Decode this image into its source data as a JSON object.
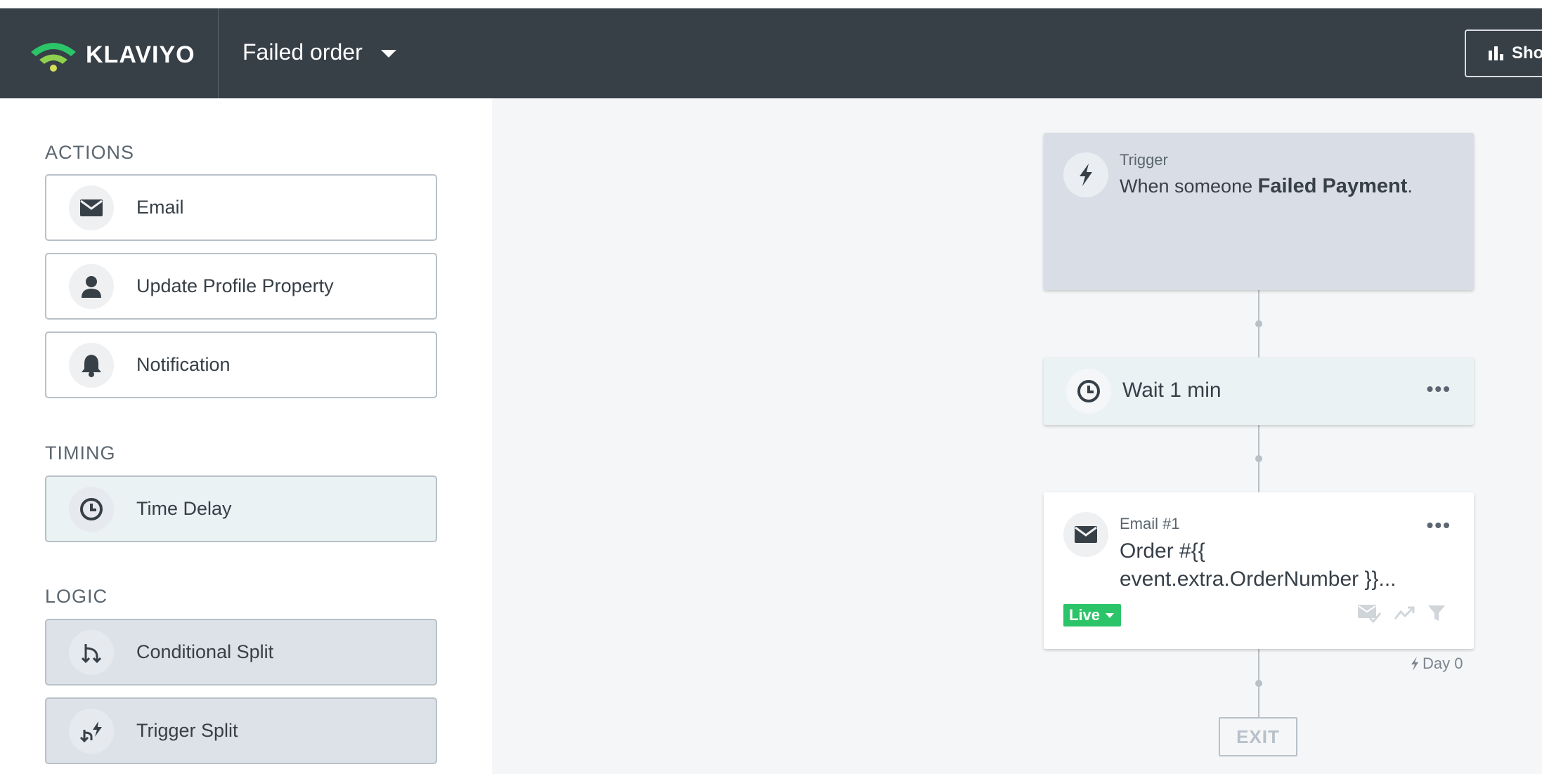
{
  "app": {
    "brand": "KLAVIYO",
    "flow_name": "Failed order",
    "show_button": "Sho"
  },
  "sidebar": {
    "actions_title": "ACTIONS",
    "actions": [
      {
        "label": "Email",
        "icon": "envelope-icon"
      },
      {
        "label": "Update Profile Property",
        "icon": "person-icon"
      },
      {
        "label": "Notification",
        "icon": "bell-icon"
      }
    ],
    "timing_title": "TIMING",
    "timing": [
      {
        "label": "Time Delay",
        "icon": "clock-icon"
      }
    ],
    "logic_title": "LOGIC",
    "logic": [
      {
        "label": "Conditional Split",
        "icon": "split-icon"
      },
      {
        "label": "Trigger Split",
        "icon": "trigger-split-icon"
      }
    ]
  },
  "canvas": {
    "trigger": {
      "label": "Trigger",
      "text_prefix": "When someone ",
      "event": "Failed Payment",
      "text_suffix": "."
    },
    "wait": {
      "text": "Wait 1 min",
      "menu": "•••"
    },
    "email": {
      "label": "Email #1",
      "subject_line1": "Order #{{",
      "subject_line2": "event.extra.OrderNumber }}...",
      "status": "Live",
      "menu": "•••"
    },
    "day_label": "Day 0",
    "exit_label": "EXIT"
  },
  "colors": {
    "header_bg": "#373f47",
    "live_green": "#2cc469",
    "logo_green": "#2cc469",
    "logo_yellow": "#d4e157"
  }
}
